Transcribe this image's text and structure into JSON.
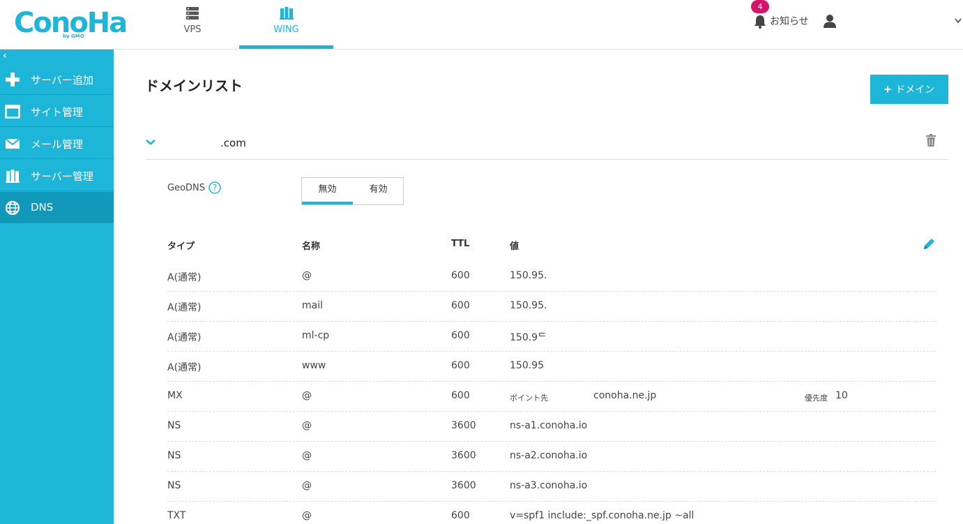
{
  "logo": {
    "text": "ConoHa",
    "sub": "by GMO"
  },
  "topnav": [
    {
      "label": "VPS",
      "icon": "server-icon"
    },
    {
      "label": "WING",
      "icon": "wing-icon",
      "active": true
    }
  ],
  "header": {
    "notify_label": "お知らせ",
    "notify_count": "4"
  },
  "sidebar": {
    "collapse": "‹",
    "items": [
      {
        "label": "サーバー追加",
        "icon": "plus-icon"
      },
      {
        "label": "サイト管理",
        "icon": "window-icon"
      },
      {
        "label": "メール管理",
        "icon": "mail-icon"
      },
      {
        "label": "サーバー管理",
        "icon": "server-manage-icon"
      },
      {
        "label": "DNS",
        "icon": "globe-icon",
        "active": true
      }
    ]
  },
  "main": {
    "title": "ドメインリスト",
    "add_domain_label": "ドメイン",
    "domain": ".com",
    "geodns": {
      "label": "GeoDNS",
      "off": "無効",
      "on": "有効",
      "selected": "無効"
    },
    "table": {
      "headers": {
        "type": "タイプ",
        "name": "名称",
        "ttl": "TTL",
        "value": "値"
      },
      "rows": [
        {
          "type": "A(通常)",
          "name": "@",
          "ttl": "600",
          "value": "150.95."
        },
        {
          "type": "A(通常)",
          "name": "mail",
          "ttl": "600",
          "value": "150.95."
        },
        {
          "type": "A(通常)",
          "name": "ml-cp",
          "ttl": "600",
          "value": "150.9ᄃ"
        },
        {
          "type": "A(通常)",
          "name": "www",
          "ttl": "600",
          "value": "150.95"
        },
        {
          "type": "MX",
          "name": "@",
          "ttl": "600",
          "value_label": "ポイント先",
          "value": "conoha.ne.jp",
          "priority_label": "優先度",
          "priority": "10"
        },
        {
          "type": "NS",
          "name": "@",
          "ttl": "3600",
          "value": "ns-a1.conoha.io"
        },
        {
          "type": "NS",
          "name": "@",
          "ttl": "3600",
          "value": "ns-a2.conoha.io"
        },
        {
          "type": "NS",
          "name": "@",
          "ttl": "3600",
          "value": "ns-a3.conoha.io"
        },
        {
          "type": "TXT",
          "name": "@",
          "ttl": "600",
          "value": "v=spf1 include:_spf.conoha.ne.jp ~all"
        }
      ]
    }
  },
  "colors": {
    "accent": "#1db5d8",
    "sidebar_active": "#1299b9",
    "badge": "#d6146b"
  }
}
